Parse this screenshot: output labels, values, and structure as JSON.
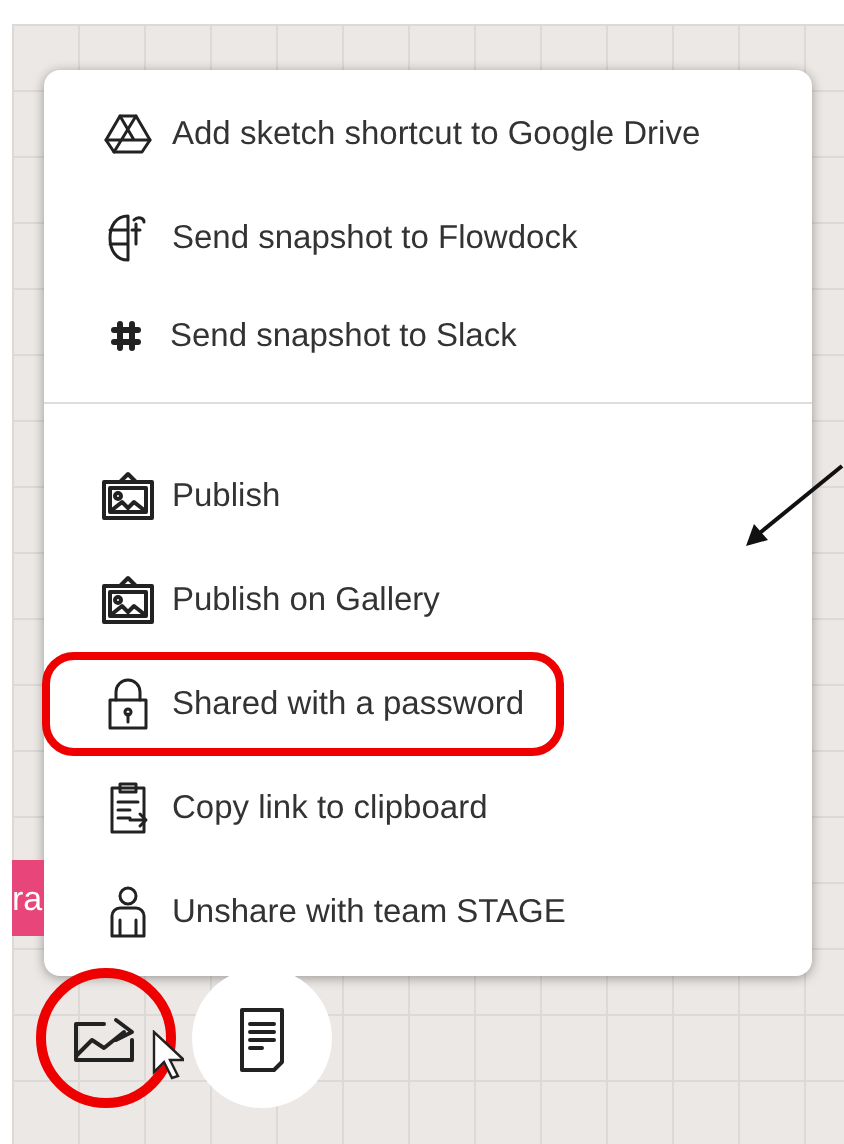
{
  "menu": {
    "groups": [
      {
        "items": [
          {
            "label": "Add sketch shortcut to Google Drive",
            "annotated": false
          },
          {
            "label": "Send snapshot to Flowdock",
            "annotated": false
          },
          {
            "label": "Send snapshot to Slack",
            "annotated": false
          }
        ]
      },
      {
        "items": [
          {
            "label": "Publish",
            "annotated": false
          },
          {
            "label": "Publish on Gallery",
            "annotated": false
          },
          {
            "label": "Shared with a password",
            "annotated": true
          },
          {
            "label": "Copy link to clipboard",
            "annotated": false
          },
          {
            "label": "Unshare with team STAGE",
            "annotated": false
          }
        ]
      }
    ]
  },
  "side_tag": {
    "label": "ra"
  },
  "toolbar": [
    {
      "kind": "share",
      "annotated": true
    },
    {
      "kind": "notes",
      "annotated": false
    }
  ]
}
